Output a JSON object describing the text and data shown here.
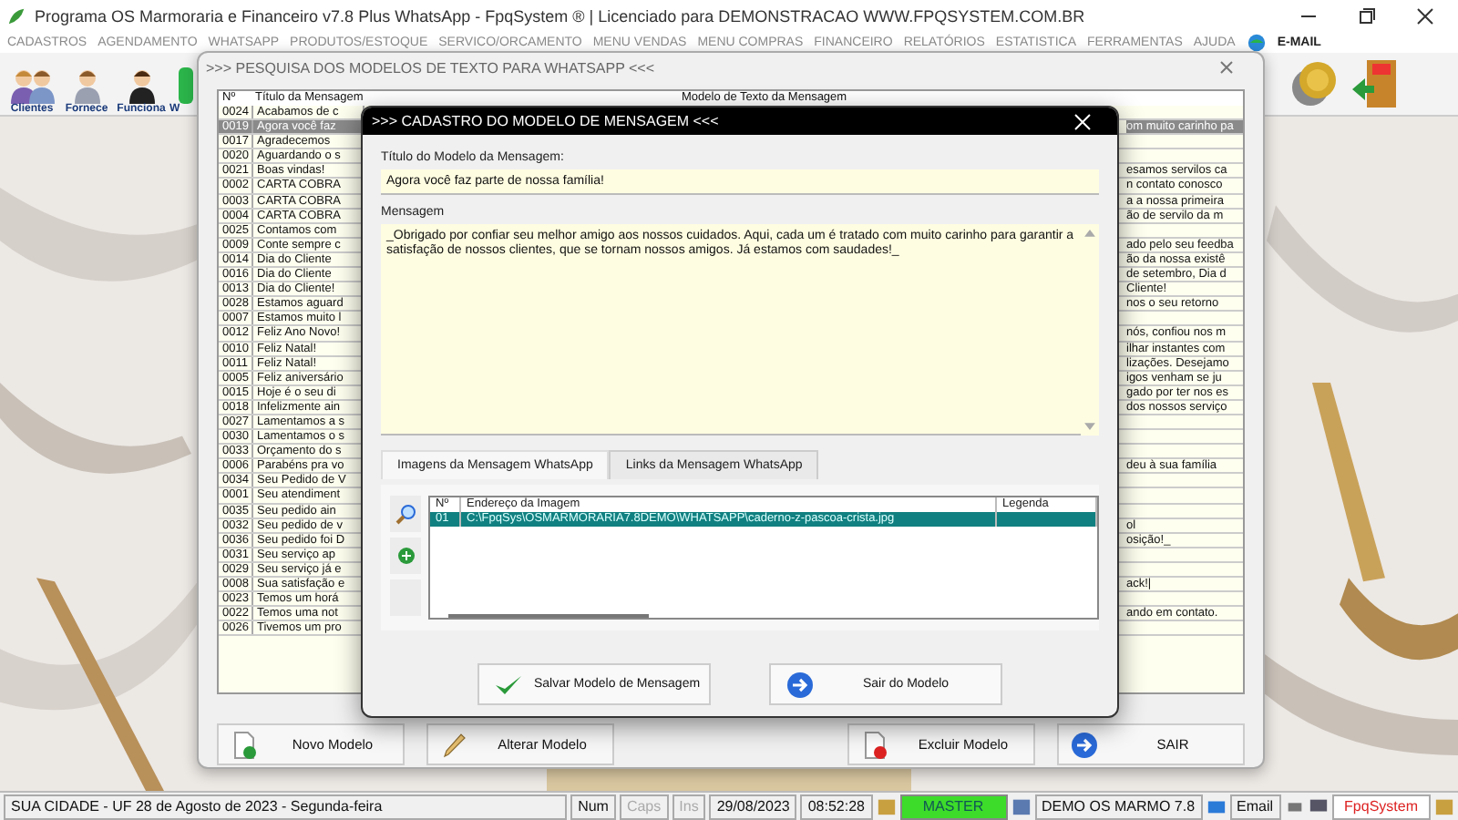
{
  "window": {
    "title": "Programa OS Marmoraria e Financeiro v7.8 Plus WhatsApp - FpqSystem ® | Licenciado para  DEMONSTRACAO WWW.FPQSYSTEM.COM.BR"
  },
  "menu": [
    "CADASTROS",
    "AGENDAMENTO",
    "WHATSAPP",
    "PRODUTOS/ESTOQUE",
    "SERVICO/ORCAMENTO",
    "MENU VENDAS",
    "MENU COMPRAS",
    "FINANCEIRO",
    "RELATÓRIOS",
    "ESTATISTICA",
    "FERRAMENTAS",
    "AJUDA"
  ],
  "email_menu": "E-MAIL",
  "toolbar": {
    "left": [
      {
        "label": "Clientes",
        "kind": "group"
      },
      {
        "label": "Fornece",
        "kind": "man"
      },
      {
        "label": "Funciona",
        "kind": "woman"
      },
      {
        "label": "W",
        "kind": "chat"
      }
    ],
    "right": [
      {
        "kind": "coin"
      },
      {
        "kind": "exit"
      }
    ]
  },
  "search_window": {
    "title": ">>> PESQUISA DOS MODELOS DE TEXTO PARA WHATSAPP <<<",
    "columns": [
      "Nº",
      "Título da Mensagem",
      "Modelo de Texto da Mensagem"
    ],
    "rows": [
      {
        "number": "0024",
        "title": "Acabamos de c",
        "selected": false
      },
      {
        "number": "0019",
        "title": "Agora você faz",
        "message": "om muito carinho pa",
        "selected": true
      },
      {
        "number": "0017",
        "title": "Agradecemos",
        "selected": false
      },
      {
        "number": "0020",
        "title": "Aguardando o s",
        "selected": false
      },
      {
        "number": "0021",
        "title": "Boas vindas!",
        "message": "esamos servilos ca",
        "selected": false
      },
      {
        "number": "0002",
        "title": "CARTA COBRA",
        "message": "n contato conosco",
        "selected": false
      },
      {
        "number": "0003",
        "title": "CARTA COBRA",
        "message": "a a nossa primeira",
        "selected": false
      },
      {
        "number": "0004",
        "title": "CARTA COBRA",
        "message": "ão de servilo da m",
        "selected": false
      },
      {
        "number": "0025",
        "title": "Contamos com",
        "selected": false
      },
      {
        "number": "0009",
        "title": "Conte sempre c",
        "message": "ado pelo seu feedba",
        "selected": false
      },
      {
        "number": "0014",
        "title": "Dia do Cliente",
        "message": "ão da nossa existê",
        "selected": false
      },
      {
        "number": "0016",
        "title": "Dia do Cliente",
        "message": "de setembro, Dia d",
        "selected": false
      },
      {
        "number": "0013",
        "title": "Dia do Cliente!",
        "message": "Cliente!",
        "selected": false
      },
      {
        "number": "0028",
        "title": "Estamos aguard",
        "message": "nos o seu retorno",
        "selected": false
      },
      {
        "number": "0007",
        "title": "Estamos muito l",
        "selected": false
      },
      {
        "number": "0012",
        "title": "Feliz Ano Novo!",
        "message": "nós, confiou nos m",
        "selected": false
      },
      {
        "number": "0010",
        "title": "Feliz Natal!",
        "message": "ilhar instantes com",
        "selected": false
      },
      {
        "number": "0011",
        "title": "Feliz Natal!",
        "message": "lizações. Desejamo",
        "selected": false
      },
      {
        "number": "0005",
        "title": "Feliz aniversário",
        "message": "igos venham se ju",
        "selected": false
      },
      {
        "number": "0015",
        "title": "Hoje é o seu di",
        "message": "gado por ter nos es",
        "selected": false
      },
      {
        "number": "0018",
        "title": "Infelizmente ain",
        "message": "dos nossos serviço",
        "selected": false
      },
      {
        "number": "0027",
        "title": "Lamentamos a s",
        "selected": false
      },
      {
        "number": "0030",
        "title": "Lamentamos o s",
        "selected": false
      },
      {
        "number": "0033",
        "title": "Orçamento do s",
        "selected": false
      },
      {
        "number": "0006",
        "title": "Parabéns pra vo",
        "message": "deu à sua família",
        "selected": false
      },
      {
        "number": "0034",
        "title": "Seu Pedido de V",
        "selected": false
      },
      {
        "number": "0001",
        "title": "Seu atendiment",
        "selected": false
      },
      {
        "number": "0035",
        "title": "Seu pedido ain",
        "selected": false
      },
      {
        "number": "0032",
        "title": "Seu pedido de v",
        "message": "ol",
        "selected": false
      },
      {
        "number": "0036",
        "title": "Seu pedido foi D",
        "message": "osição!_",
        "selected": false
      },
      {
        "number": "0031",
        "title": "Seu serviço ap",
        "selected": false
      },
      {
        "number": "0029",
        "title": "Seu serviço já e",
        "selected": false
      },
      {
        "number": "0008",
        "title": "Sua satisfação e",
        "message": "ack!|",
        "selected": false
      },
      {
        "number": "0023",
        "title": "Temos um horá",
        "selected": false
      },
      {
        "number": "0022",
        "title": "Temos uma not",
        "message": "ando em contato.",
        "selected": false
      },
      {
        "number": "0026",
        "title": "Tivemos um pro",
        "selected": false
      }
    ],
    "buttons": [
      {
        "label": "Novo Modelo",
        "kind": "new"
      },
      {
        "label": "Alterar Modelo",
        "kind": "edit"
      },
      {
        "label": "Excluir Modelo",
        "kind": "delete"
      },
      {
        "label": "SAIR",
        "kind": "exit"
      }
    ]
  },
  "modal": {
    "title": ">>> CADASTRO DO MODELO DE MENSAGEM <<<",
    "title_label": "Título do Modelo da Mensagem:",
    "title_value": "Agora você faz parte de nossa família!",
    "message_label": "Mensagem",
    "message_value": "_Obrigado por confiar seu melhor amigo aos nossos cuidados. Aqui, cada um é tratado com muito carinho para garantir a satisfação de nossos clientes, que se tornam nossos amigos. Já estamos com saudades!_",
    "tabs": [
      {
        "label": "Imagens da Mensagem WhatsApp",
        "selected": true
      },
      {
        "label": "Links da Mensagem WhatsApp",
        "selected": false
      }
    ],
    "image_table": {
      "columns": [
        "Nº",
        "Endereço da Imagem",
        "Legenda"
      ],
      "rows": [
        {
          "number": "01",
          "path": "C:\\FpqSys\\OSMARMORARIA7.8DEMO\\WHATSAPP\\caderno-z-pascoa-crista.jpg",
          "selected": true
        }
      ]
    },
    "buttons": [
      {
        "label": "Salvar Modelo de Mensagem",
        "kind": "save"
      },
      {
        "label": "Sair do Modelo",
        "kind": "exit"
      }
    ]
  },
  "status_bar": {
    "location": "SUA CIDADE - UF 28 de Agosto de 2023 - Segunda-feira",
    "keys": [
      {
        "label": "Num",
        "on": true
      },
      {
        "label": "Caps",
        "on": false
      },
      {
        "label": "Ins",
        "on": false
      }
    ],
    "date": "29/08/2023",
    "time": "08:52:28",
    "user": "MASTER",
    "company": "DEMO OS MARMO 7.8",
    "email": "Email",
    "brand": "FpqSystem"
  }
}
